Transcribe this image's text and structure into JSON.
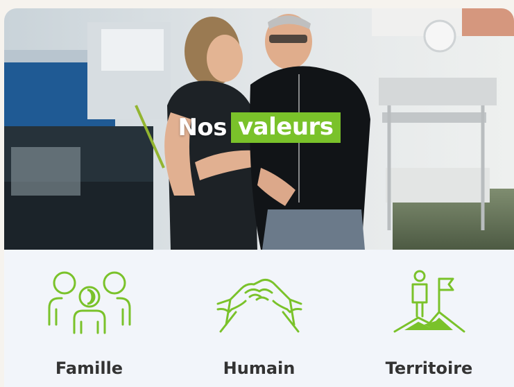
{
  "hero": {
    "title_plain": "Nos",
    "title_highlight": "valeurs"
  },
  "values": [
    {
      "label": "Famille",
      "icon": "family-icon"
    },
    {
      "label": "Humain",
      "icon": "handshake-icon"
    },
    {
      "label": "Territoire",
      "icon": "summit-flag-icon"
    }
  ],
  "colors": {
    "accent_green": "#7ac22a",
    "label_text": "#333333",
    "section_background": "#f2f5fa"
  }
}
